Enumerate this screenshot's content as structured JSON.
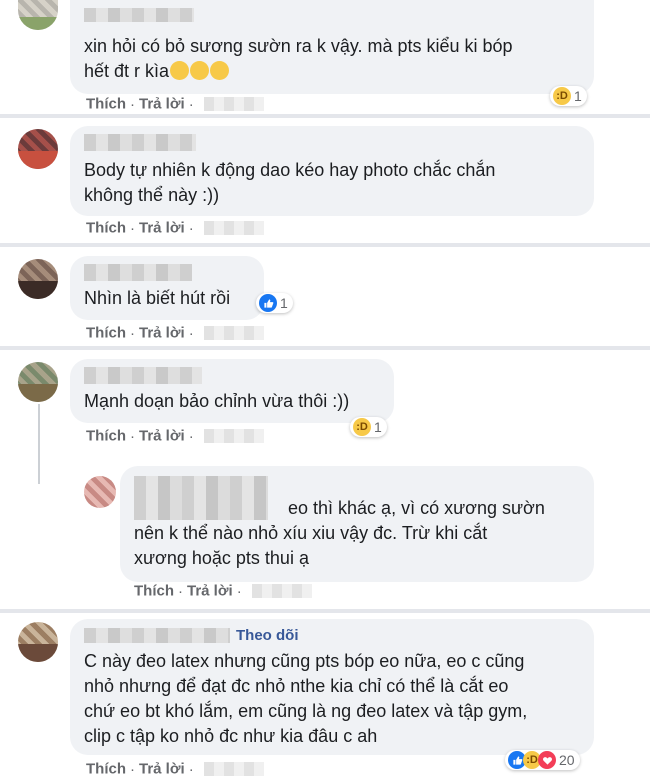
{
  "comments": [
    {
      "text": "xin hỏi có bỏ sương sườn ra k vậy. mà pts kiểu ki bóp\nhết đt r kìa",
      "actions": {
        "like": "Thích",
        "reply": "Trả lời"
      },
      "reaction": {
        "icon": "haha-icon",
        "count": "1"
      }
    },
    {
      "text": "Body tự nhiên k động dao kéo hay photo chắc chắn\nkhông thể này :))",
      "actions": {
        "like": "Thích",
        "reply": "Trả lời"
      }
    },
    {
      "text": "Nhìn là biết hút rồi",
      "actions": {
        "like": "Thích",
        "reply": "Trả lời"
      },
      "reaction": {
        "icon": "like-icon",
        "count": "1"
      }
    },
    {
      "text": "Mạnh doạn bảo chỉnh vừa thôi :))",
      "actions": {
        "like": "Thích",
        "reply": "Trả lời"
      },
      "reaction": {
        "icon": "haha-icon",
        "count": "1"
      }
    },
    {
      "text_line1": "eo thì khác ạ, vì có xương sườn",
      "text_rest": "nên k thể nào nhỏ xíu xiu vậy đc. Trừ khi cắt\nxương hoặc pts thui ạ",
      "actions": {
        "like": "Thích",
        "reply": "Trả lời"
      }
    },
    {
      "follow": "Theo dõi",
      "text": "C này đeo latex nhưng cũng pts bóp eo nữa, eo c cũng\nnhỏ nhưng để đạt đc nhỏ nthe kia chỉ có thể là cắt eo\nchứ eo bt khó lắm, em cũng là ng đeo latex và tập gym,\nclip c tập ko nhỏ đc như kia đâu c ah",
      "actions": {
        "like": "Thích",
        "reply": "Trả lời"
      },
      "reaction": {
        "icons": [
          "like-icon",
          "haha-icon",
          "love-icon"
        ],
        "count": "20"
      }
    }
  ],
  "colors": {
    "bubble": "#f0f2f5",
    "text": "#1c1e21",
    "meta": "#65676b",
    "link": "#385898",
    "like": "#1877f2",
    "haha": "#f7c948",
    "love": "#f33e58"
  }
}
